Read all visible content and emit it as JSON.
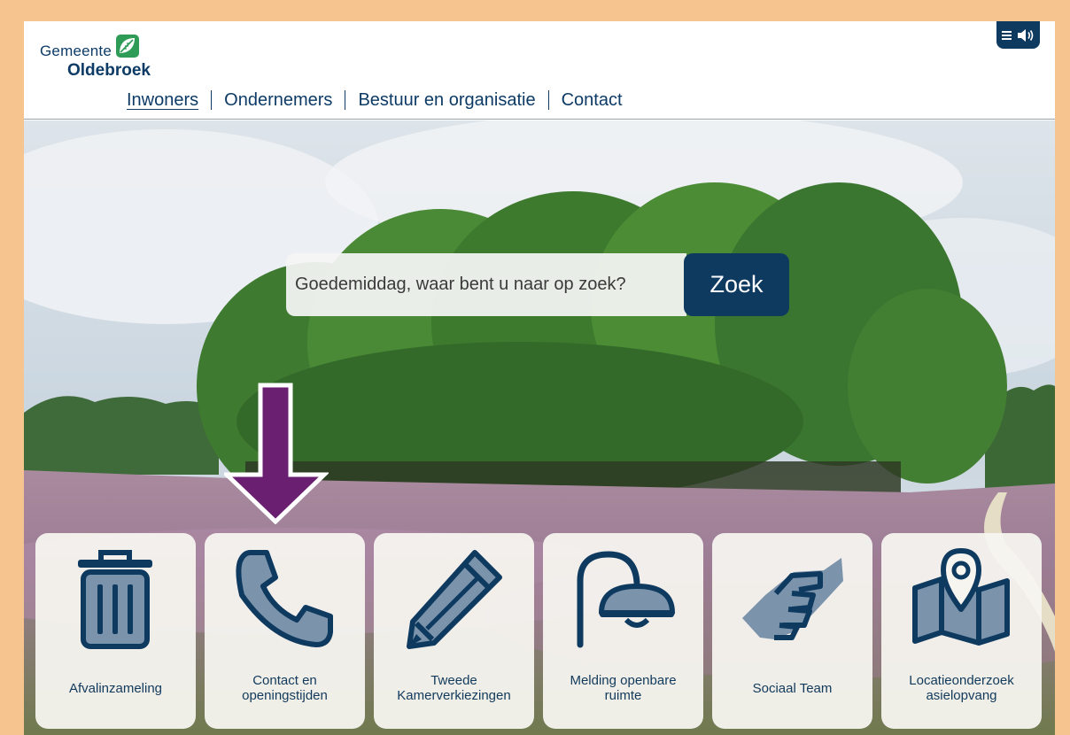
{
  "logo": {
    "line1": "Gemeente",
    "line2": "Oldebroek"
  },
  "accessibility": {
    "menu_icon": "list-icon",
    "speaker_icon": "speaker-icon"
  },
  "nav": {
    "items": [
      {
        "label": "Inwoners",
        "active": true
      },
      {
        "label": "Ondernemers",
        "active": false
      },
      {
        "label": "Bestuur en organisatie",
        "active": false
      },
      {
        "label": "Contact",
        "active": false
      }
    ]
  },
  "search": {
    "placeholder": "Goedemiddag, waar bent u naar op zoek?",
    "value": "",
    "button_label": "Zoek"
  },
  "tiles": [
    {
      "label": "Afvalinzameling",
      "icon": "trash-bin-icon"
    },
    {
      "label": "Contact en\nopeningstijden",
      "icon": "phone-icon"
    },
    {
      "label": "Tweede\nKamerverkiezingen",
      "icon": "pencil-icon"
    },
    {
      "label": "Melding openbare\nruimte",
      "icon": "street-lamp-icon"
    },
    {
      "label": "Sociaal Team",
      "icon": "handshake-icon"
    },
    {
      "label": "Locatieonderzoek\nasielopvang",
      "icon": "map-pin-icon"
    }
  ],
  "colors": {
    "brand": "#0f3a60",
    "frame": "#f5c48f",
    "arrow": "#6a1f71",
    "icon_fill": "#7b93ab"
  }
}
